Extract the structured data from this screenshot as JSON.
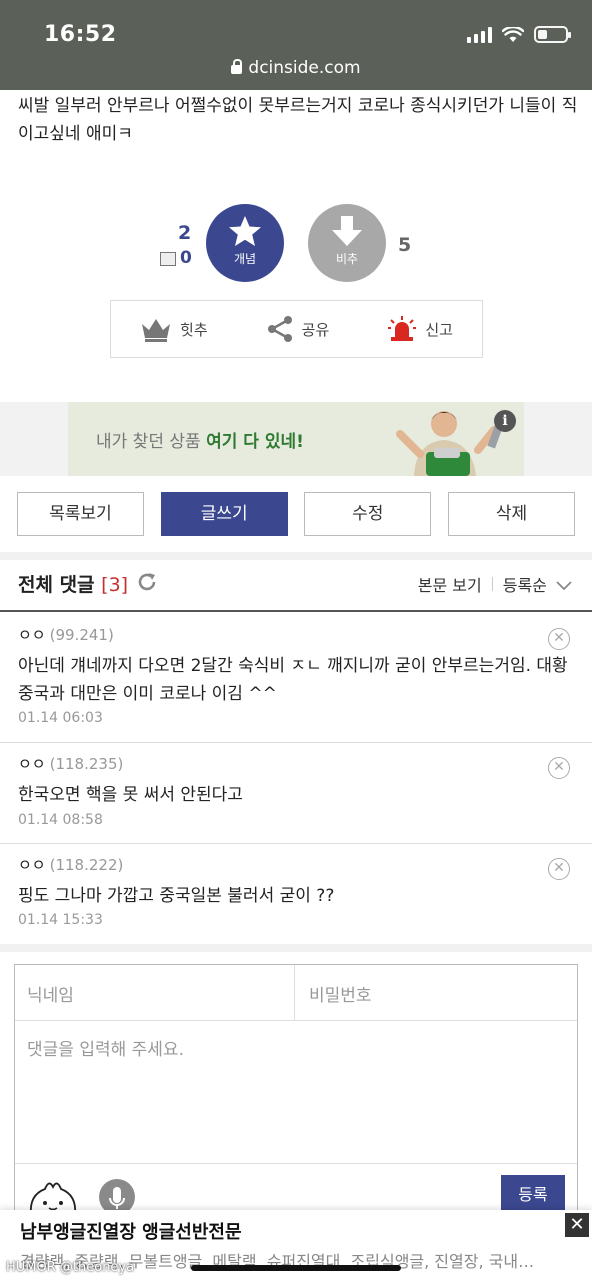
{
  "status_bar": {
    "time": "16:52"
  },
  "browser": {
    "url": "dcinside.com"
  },
  "post": {
    "body_text": "씨발 일부러 안부르나 어쩔수없이 못부르는거지 코로나 종식시키던가 니들이 직이고싶네 애미ㅋ"
  },
  "vote": {
    "up_count": "2",
    "fix_count": "0",
    "up_label": "개념",
    "down_label": "비추",
    "down_count": "5"
  },
  "sub_actions": [
    {
      "label": "힛추",
      "icon": "crown-icon"
    },
    {
      "label": "공유",
      "icon": "share-icon"
    },
    {
      "label": "신고",
      "icon": "siren-icon"
    }
  ],
  "ad_banner": {
    "text_normal": "내가 찾던 상품 ",
    "text_bold": "여기 다 있네!",
    "info": "i"
  },
  "buttons": {
    "list": "목록보기",
    "write": "글쓰기",
    "edit": "수정",
    "delete": "삭제"
  },
  "comments_header": {
    "title": "전체 댓글",
    "count": "[3]",
    "view_body": "본문 보기",
    "sort": "등록순"
  },
  "comments": [
    {
      "name": "ㅇㅇ",
      "ip": "(99.241)",
      "text": "아닌데 걔네까지 다오면 2달간 숙식비 ㅈㄴ 깨지니까 굳이 안부르는거임. 대황중국과 대만은 이미 코로나 이김 ^^",
      "date": "01.14 06:03"
    },
    {
      "name": "ㅇㅇ",
      "ip": "(118.235)",
      "text": "한국오면 핵을 못 써서 안된다고",
      "date": "01.14 08:58"
    },
    {
      "name": "ㅇㅇ",
      "ip": "(118.222)",
      "text": "핑도 그나마 가깝고 중국일본 불러서 굳이 ??",
      "date": "01.14 15:33"
    }
  ],
  "comment_form": {
    "nickname_placeholder": "닉네임",
    "password_placeholder": "비밀번호",
    "body_placeholder": "댓글을 입력해 주세요.",
    "submit": "등록"
  },
  "bottom_ad": {
    "title": "남부앵글진열장 앵글선반전문",
    "subtitle": "경량랙, 중량랙, 무볼트앵글, 메탈랙, 슈퍼진열대, 조립식앵글, 진열장, 국내…",
    "close": "✕"
  },
  "watermark": "HUMOR @theoneya",
  "colors": {
    "accent": "#3b4890",
    "count_red": "#c23030",
    "siren_red": "#d8281f"
  }
}
